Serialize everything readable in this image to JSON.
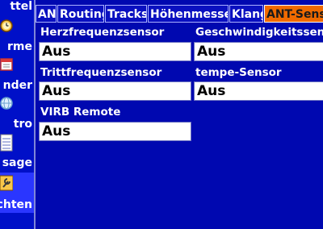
{
  "sidebar": {
    "items": [
      {
        "label": "ttel",
        "icon": "tools-icon"
      },
      {
        "label": "rme",
        "icon": "alarm-icon"
      },
      {
        "label": "nder",
        "icon": "calendar-icon"
      },
      {
        "label": "tro",
        "icon": "globe-icon"
      },
      {
        "label": "sage",
        "icon": "note-icon"
      },
      {
        "label": "chten",
        "icon": "wrench-settings-icon"
      }
    ],
    "selected_index": 5
  },
  "tabs": [
    {
      "label": "AN"
    },
    {
      "label": "Routing"
    },
    {
      "label": "Tracks"
    },
    {
      "label": "Höhenmesser"
    },
    {
      "label": "Klang"
    },
    {
      "label": "ANT-Senso"
    }
  ],
  "active_tab_index": 5,
  "fields": {
    "heart_rate": {
      "label": "Herzfrequenzsensor",
      "value": "Aus"
    },
    "speed": {
      "label": "Geschwindigkeitssenso",
      "value": "Aus"
    },
    "cadence": {
      "label": "Trittfrequenzsensor",
      "value": "Aus"
    },
    "tempe": {
      "label": "tempe-Sensor",
      "value": "Aus"
    },
    "virb": {
      "label": "VIRB Remote",
      "value": "Aus"
    }
  },
  "colors": {
    "background": "#0008b0",
    "active_tab": "#f06a00",
    "field_bg": "#ffffff"
  }
}
